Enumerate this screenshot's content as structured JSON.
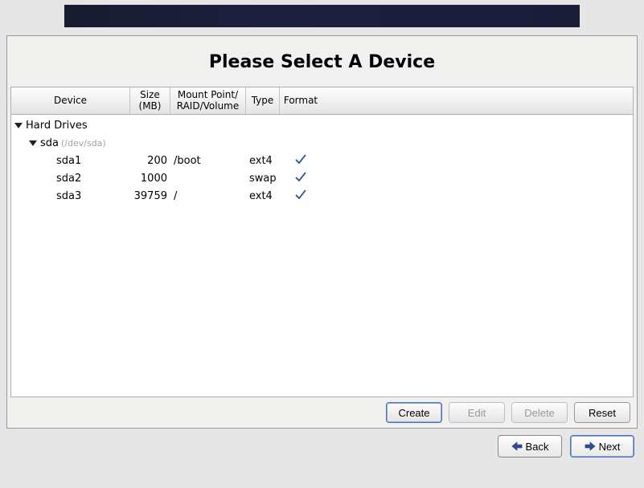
{
  "title": "Please Select A Device",
  "columns": {
    "device": "Device",
    "size": "Size\n(MB)",
    "mount": "Mount Point/\nRAID/Volume",
    "type": "Type",
    "format": "Format"
  },
  "tree": {
    "root_label": "Hard Drives",
    "disk": {
      "name": "sda",
      "path": "(/dev/sda)"
    },
    "partitions": [
      {
        "name": "sda1",
        "size": "200",
        "mount": "/boot",
        "type": "ext4",
        "format": true
      },
      {
        "name": "sda2",
        "size": "1000",
        "mount": "",
        "type": "swap",
        "format": true
      },
      {
        "name": "sda3",
        "size": "39759",
        "mount": "/",
        "type": "ext4",
        "format": true
      }
    ]
  },
  "buttons": {
    "create": "Create",
    "edit": "Edit",
    "delete": "Delete",
    "reset": "Reset"
  },
  "nav": {
    "back": "Back",
    "next": "Next"
  }
}
